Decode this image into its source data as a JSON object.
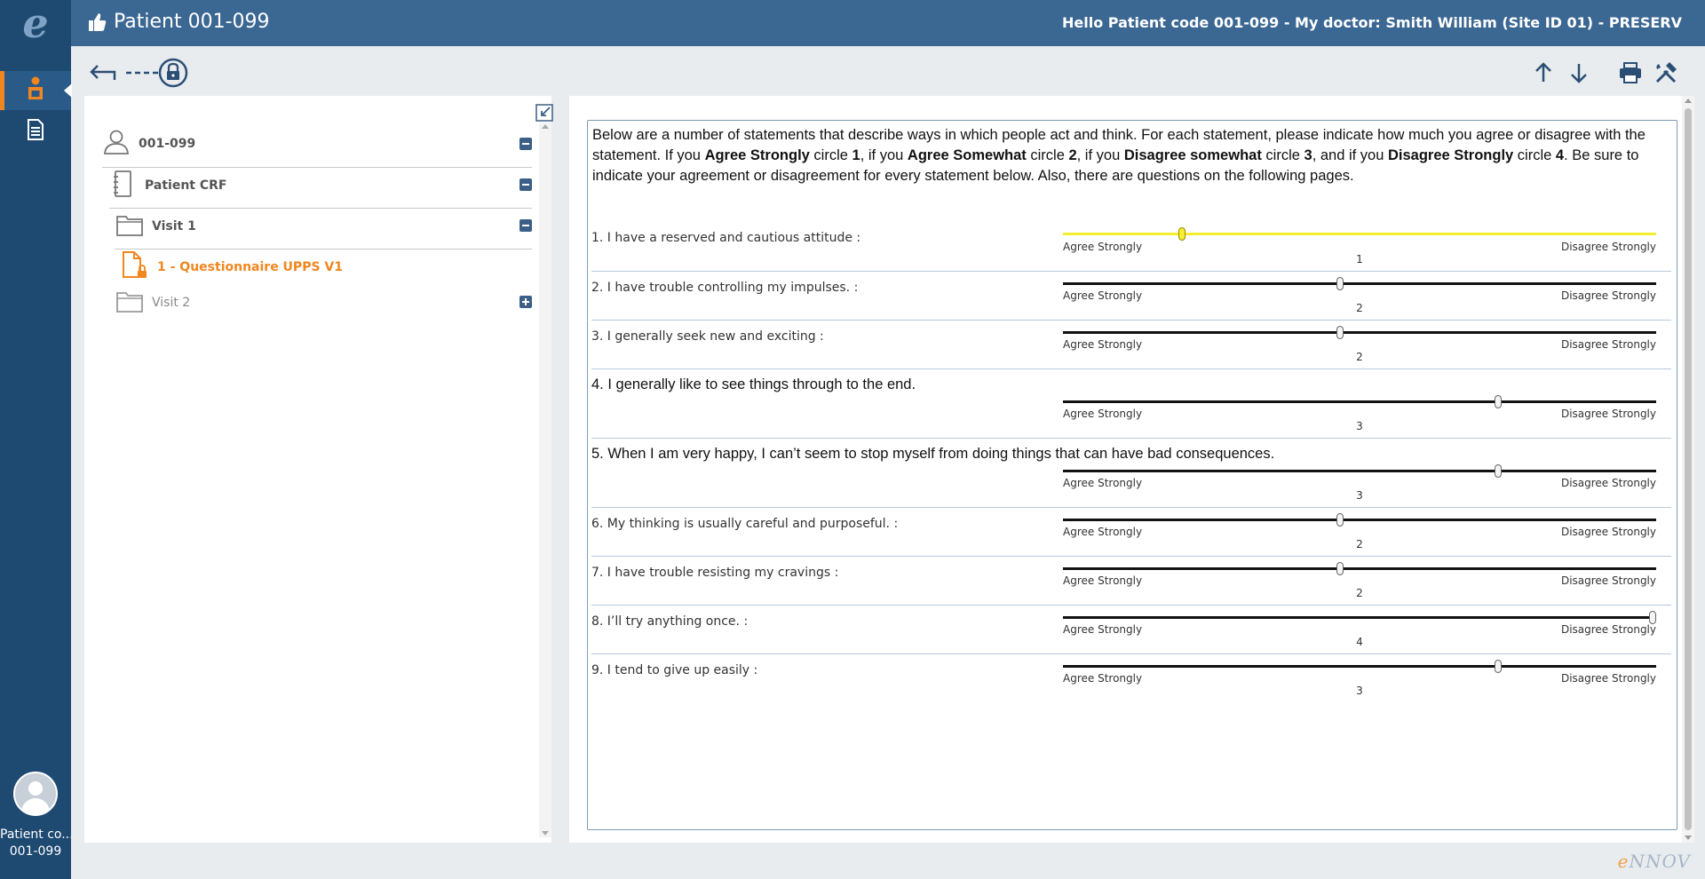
{
  "header": {
    "title": "Patient 001-099",
    "greeting": "Hello Patient code 001-099 - My doctor: Smith William (Site ID 01) - PRESERV"
  },
  "app": {
    "logo": "e"
  },
  "user": {
    "line1": "Patient co...",
    "line2": "001-099"
  },
  "tree": {
    "patient": "001-099",
    "crf": "Patient CRF",
    "visit1": "Visit 1",
    "questionnaire": "1 - Questionnaire UPPS V1",
    "visit2": "Visit 2"
  },
  "questions": [
    {
      "text": "1. I have a reserved and cautious attitude :",
      "value": 1,
      "left": "Agree Strongly",
      "right": "Disagree Strongly"
    },
    {
      "text": "2. I have trouble controlling my impulses. :",
      "value": 2,
      "left": "Agree Strongly",
      "right": "Disagree Strongly"
    },
    {
      "text": "3. I generally seek new and exciting :",
      "value": 2,
      "left": "Agree Strongly",
      "right": "Disagree Strongly"
    },
    {
      "text": "4. I generally like to see things through to the end.",
      "value": 3,
      "left": "Agree Strongly",
      "right": "Disagree Strongly"
    },
    {
      "text": "5. When I am very happy, I can’t seem to stop myself from doing things that can have bad consequences.",
      "value": 3,
      "left": "Agree Strongly",
      "right": "Disagree Strongly"
    },
    {
      "text": "6. My thinking is usually careful and purposeful. :",
      "value": 2,
      "left": "Agree Strongly",
      "right": "Disagree Strongly"
    },
    {
      "text": "7. I have trouble resisting my cravings :",
      "value": 2,
      "left": "Agree Strongly",
      "right": "Disagree Strongly"
    },
    {
      "text": "8. I’ll try anything once. :",
      "value": 4,
      "left": "Agree Strongly",
      "right": "Disagree Strongly"
    },
    {
      "text": "9. I tend to give up easily :",
      "value": 3,
      "left": "Agree Strongly",
      "right": "Disagree Strongly"
    }
  ],
  "slider_scale": {
    "min": 0.25,
    "max": 4
  },
  "intro": {
    "p1": "Below are a number of statements that describe ways in which people act and think. For each statement, please indicate how much you agree or disagree with the statement. If you ",
    "b1": "Agree Strongly",
    "p2": " circle ",
    "b2": "1",
    "p3": ", if you ",
    "b3": "Agree Somewhat",
    "p4": " circle ",
    "b4": "2",
    "p5": ", if you ",
    "b5": "Disagree somewhat",
    "p6": " circle ",
    "b6": "3",
    "p7": ", and if you ",
    "b7": "Disagree Strongly",
    "p8": " circle ",
    "b8": "4",
    "p9": ". Be sure to indicate your agreement or disagreement for every statement below. Also, there are questions on the following pages."
  },
  "brand": {
    "e": "e",
    "rest": "NNOV"
  },
  "colors": {
    "topbar": "#3b6793",
    "leftnav": "#1e4a72",
    "accent": "#f0861f",
    "selected": "#f5ed31"
  },
  "icons": [
    "thumbs-up-icon",
    "patient-icon",
    "document-icon",
    "back-arrow-icon",
    "lock-icon",
    "arrow-up-icon",
    "arrow-down-icon",
    "print-icon",
    "tools-icon",
    "collapse-icon",
    "user-icon",
    "notebook-icon",
    "folder-icon",
    "locked-file-icon"
  ]
}
